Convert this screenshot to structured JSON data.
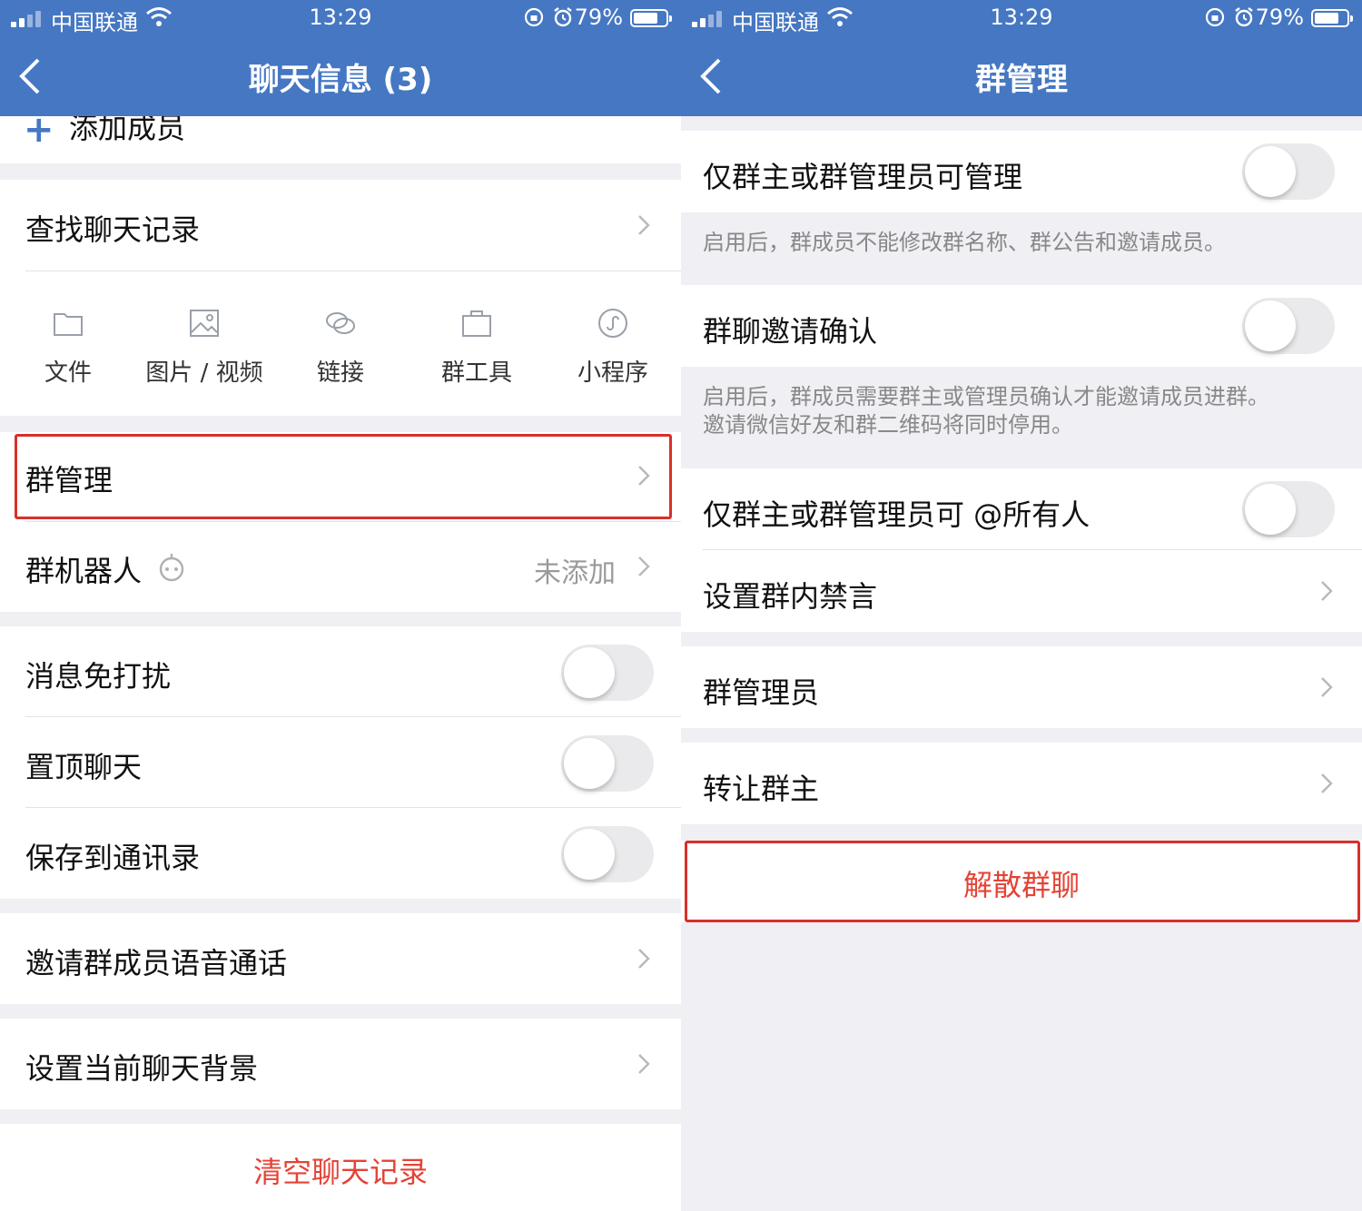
{
  "status_bar": {
    "carrier": "中国联通",
    "time": "13:29",
    "battery": "79%"
  },
  "left": {
    "nav_title": "聊天信息 (3)",
    "add_member": "添加成员",
    "search_history": "查找聊天记录",
    "tools": [
      {
        "label": "文件",
        "icon": "folder-icon"
      },
      {
        "label": "图片 / 视频",
        "icon": "image-icon"
      },
      {
        "label": "链接",
        "icon": "link-icon"
      },
      {
        "label": "群工具",
        "icon": "toolbox-icon"
      },
      {
        "label": "小程序",
        "icon": "miniprogram-icon"
      }
    ],
    "group_manage": "群管理",
    "group_robot": "群机器人",
    "group_robot_value": "未添加",
    "mute": "消息免打扰",
    "pin": "置顶聊天",
    "save_contacts": "保存到通讯录",
    "voice_call": "邀请群成员语音通话",
    "chat_background": "设置当前聊天背景",
    "clear_history": "清空聊天记录"
  },
  "right": {
    "nav_title": "群管理",
    "owner_admin_only": "仅群主或群管理员可管理",
    "owner_admin_only_hint": "启用后，群成员不能修改群名称、群公告和邀请成员。",
    "invite_confirm": "群聊邀请确认",
    "invite_confirm_hint_1": "启用后，群成员需要群主或管理员确认才能邀请成员进群。",
    "invite_confirm_hint_2": "邀请微信好友和群二维码将同时停用。",
    "at_all": "仅群主或群管理员可 @所有人",
    "mute_members": "设置群内禁言",
    "admins": "群管理员",
    "transfer_owner": "转让群主",
    "dissolve": "解散群聊"
  },
  "colors": {
    "nav_blue": "#4577c3",
    "danger_red": "#e44336",
    "highlight_box": "#d8302a"
  }
}
